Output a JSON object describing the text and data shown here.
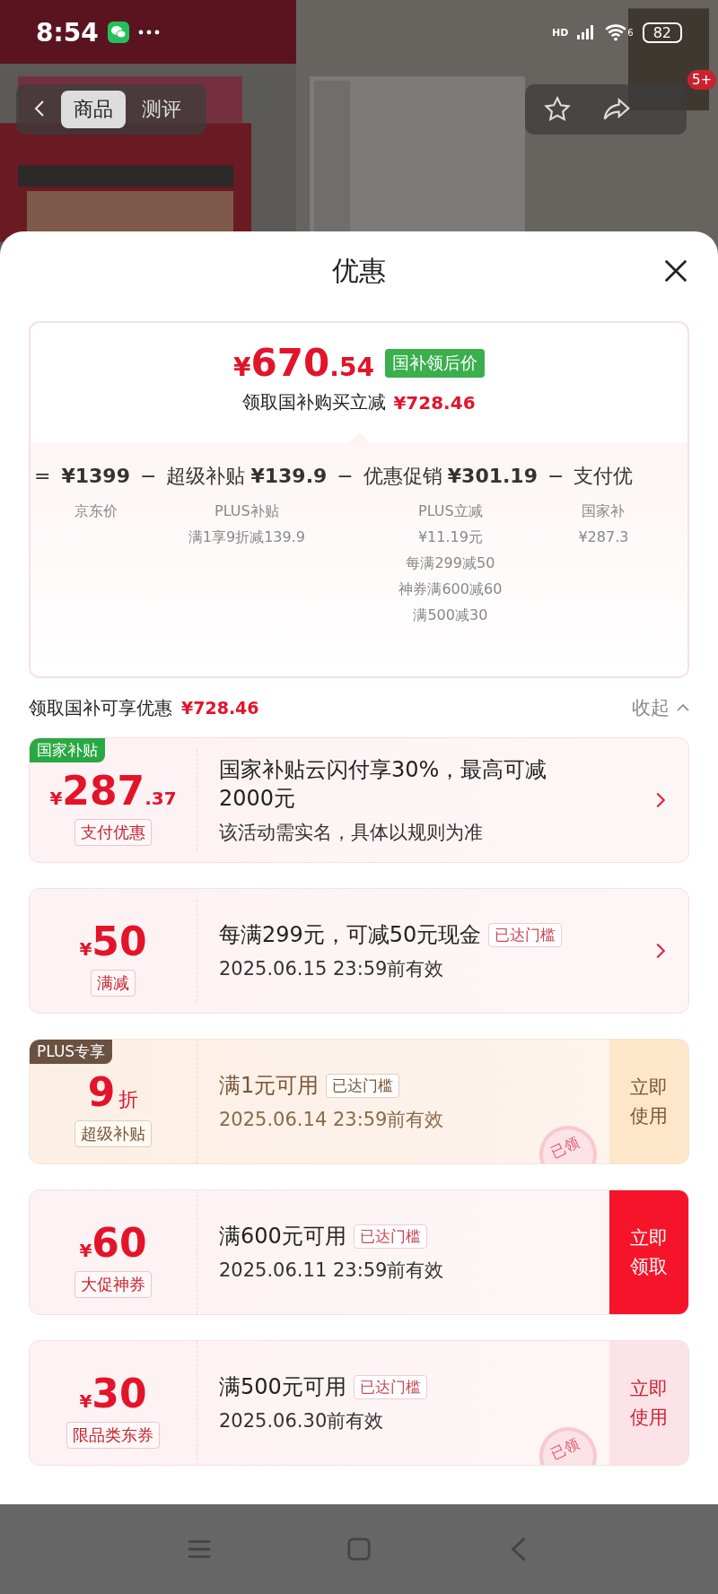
{
  "status_bar": {
    "time": "8:54",
    "network": "HD",
    "wifi_label": "6",
    "battery": "82"
  },
  "header": {
    "tabs": [
      {
        "label": "商品",
        "selected": true
      },
      {
        "label": "测评",
        "selected": false
      }
    ],
    "badge": "5+"
  },
  "sheet": {
    "title": "优惠"
  },
  "price": {
    "currency": "¥",
    "integer": "670",
    "decimal": ".54",
    "tag": "国补领后价",
    "caption": "领取国补购买立减",
    "saving": "¥728.46"
  },
  "breakdown": [
    {
      "operator": "=",
      "amount": "¥1399",
      "notes": [
        "京东价"
      ]
    },
    {
      "operator": "−",
      "label": "超级补贴",
      "amount": "¥139.9",
      "notes": [
        "PLUS补贴",
        "满1享9折减139.9"
      ]
    },
    {
      "operator": "−",
      "label": "优惠促销",
      "amount": "¥301.19",
      "notes": [
        "PLUS立减",
        "¥11.19元",
        "每满299减50",
        "神券满600减60",
        "满500减30"
      ]
    },
    {
      "operator": "−",
      "label": "支付优",
      "notes": [
        "国家补",
        "¥287.3"
      ]
    }
  ],
  "summary": {
    "label": "领取国补可享优惠",
    "amount": "¥728.46",
    "toggle": "收起",
    "expanded": true
  },
  "coupons": [
    {
      "kind": "regular",
      "tag": {
        "text": "国家补贴",
        "kind": "green"
      },
      "amount": {
        "prefix": "¥",
        "main": "287",
        "suffix": ".37"
      },
      "label": "支付优惠",
      "title": "国家补贴云闪付享30%，最高可减2000元",
      "subtitle": "该活动需实名，具体以规则为准",
      "action": {
        "kind": "chevron"
      }
    },
    {
      "kind": "regular",
      "amount": {
        "prefix": "¥",
        "main": "50"
      },
      "label": "满减",
      "title": "每满299元，可减50元现金",
      "badge": "已达门槛",
      "subtitle": "2025.06.15 23:59前有效",
      "action": {
        "kind": "chevron"
      }
    },
    {
      "kind": "plus",
      "tag": {
        "text": "PLUS专享",
        "kind": "brown"
      },
      "amount": {
        "main": "9",
        "suffix": "折"
      },
      "label": "超级补贴",
      "title": "满1元可用",
      "badge": "已达门槛",
      "subtitle": "2025.06.14 23:59前有效",
      "stamp": "已领",
      "action": {
        "kind": "use",
        "text": "立即使用"
      }
    },
    {
      "kind": "regular",
      "amount": {
        "prefix": "¥",
        "main": "60"
      },
      "label": "大促神券",
      "title": "满600元可用",
      "badge": "已达门槛",
      "subtitle": "2025.06.11 23:59前有效",
      "action": {
        "kind": "claim",
        "text": "立即领取"
      }
    },
    {
      "kind": "regular",
      "amount": {
        "prefix": "¥",
        "main": "30"
      },
      "label": "限品类东券",
      "title": "满500元可用",
      "badge": "已达门槛",
      "subtitle": "2025.06.30前有效",
      "stamp": "已领",
      "action": {
        "kind": "use",
        "text": "立即使用"
      }
    }
  ]
}
